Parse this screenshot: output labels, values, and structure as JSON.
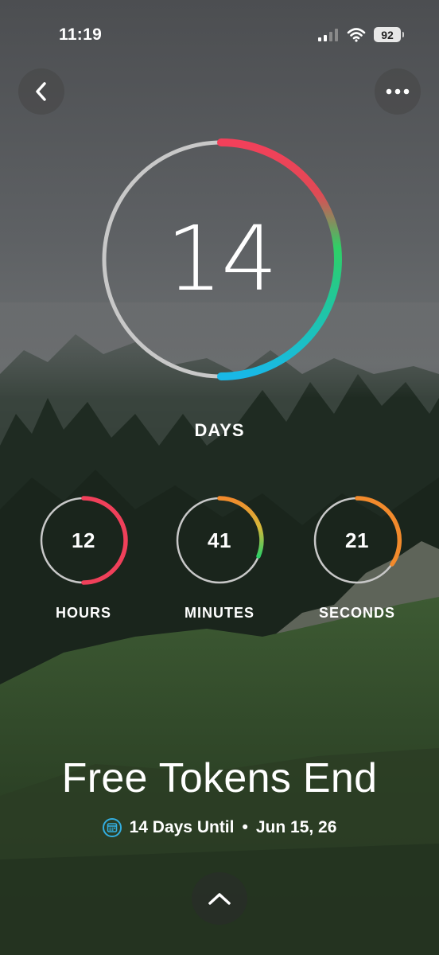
{
  "status_bar": {
    "time": "11:19",
    "battery": "92"
  },
  "countdown": {
    "days": {
      "value": "14",
      "label": "DAYS",
      "fraction": 0.5
    },
    "hours": {
      "value": "12",
      "label": "HOURS",
      "fraction": 0.5
    },
    "minutes": {
      "value": "41",
      "label": "MINUTES",
      "fraction": 0.3
    },
    "seconds": {
      "value": "21",
      "label": "SECONDS",
      "fraction": 0.35
    }
  },
  "event": {
    "title": "Free Tokens End",
    "days_until": "14 Days Until",
    "separator": "•",
    "date": "Jun 15, 26"
  },
  "colors": {
    "ring_track": "#c8c8c8",
    "ring_red": "#f0405a",
    "ring_green": "#2fcf66",
    "ring_cyan": "#18b8e8",
    "ring_orange": "#f28a2c",
    "calendar_icon": "#33aee0"
  },
  "icons": [
    "back-chevron-icon",
    "more-dots-icon",
    "signal-icon",
    "wifi-icon",
    "battery-icon",
    "calendar-icon",
    "chevron-up-icon"
  ]
}
